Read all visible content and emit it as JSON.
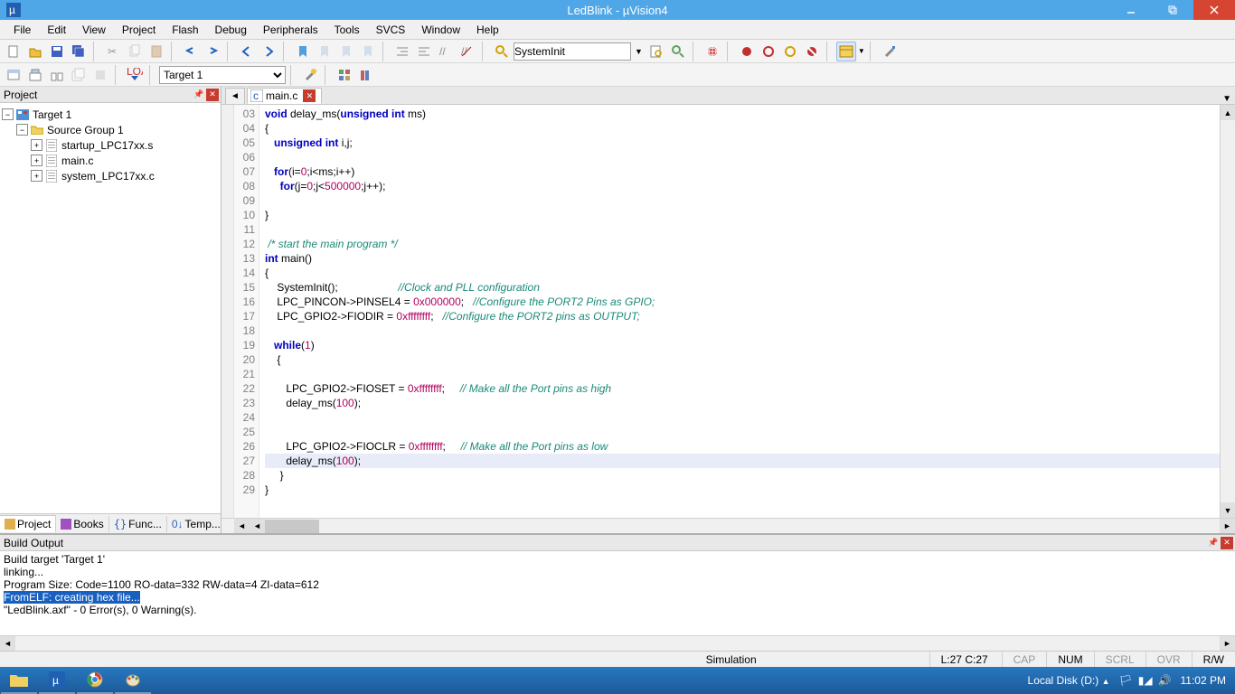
{
  "window": {
    "title": "LedBlink  - µVision4"
  },
  "menu": [
    "File",
    "Edit",
    "View",
    "Project",
    "Flash",
    "Debug",
    "Peripherals",
    "Tools",
    "SVCS",
    "Window",
    "Help"
  ],
  "toolbar": {
    "combo": "SystemInit",
    "target": "Target 1"
  },
  "project": {
    "title": "Project",
    "root": "Target 1",
    "group": "Source Group 1",
    "files": [
      "startup_LPC17xx.s",
      "main.c",
      "system_LPC17xx.c"
    ],
    "tabs": [
      "Project",
      "Books",
      "Func...",
      "Temp..."
    ]
  },
  "editor": {
    "filename": "main.c",
    "startline": 3,
    "highlight": 27,
    "lines": [
      [
        [
          "kw",
          "void"
        ],
        [
          "",
          " delay_ms("
        ],
        [
          "kw",
          "unsigned"
        ],
        [
          "",
          " "
        ],
        [
          "kw",
          "int"
        ],
        [
          "",
          " ms)"
        ]
      ],
      [
        [
          "",
          "{"
        ]
      ],
      [
        [
          "",
          "   "
        ],
        [
          "kw",
          "unsigned"
        ],
        [
          "",
          " "
        ],
        [
          "kw",
          "int"
        ],
        [
          "",
          " i,j;"
        ]
      ],
      [
        [
          "",
          ""
        ]
      ],
      [
        [
          "",
          "   "
        ],
        [
          "kw",
          "for"
        ],
        [
          "",
          "(i="
        ],
        [
          "num",
          "0"
        ],
        [
          "",
          ";i<ms;i++)"
        ]
      ],
      [
        [
          "",
          "     "
        ],
        [
          "kw",
          "for"
        ],
        [
          "",
          "(j="
        ],
        [
          "num",
          "0"
        ],
        [
          "",
          ";j<"
        ],
        [
          "num",
          "500000"
        ],
        [
          "",
          ";j++);"
        ]
      ],
      [
        [
          "",
          ""
        ]
      ],
      [
        [
          "",
          "}"
        ]
      ],
      [
        [
          "",
          ""
        ]
      ],
      [
        [
          "cmt",
          " /* start the main program */"
        ]
      ],
      [
        [
          "kw",
          "int"
        ],
        [
          "",
          " main()"
        ]
      ],
      [
        [
          "",
          "{"
        ]
      ],
      [
        [
          "",
          "    SystemInit();                    "
        ],
        [
          "cmt",
          "//Clock and PLL configuration"
        ]
      ],
      [
        [
          "",
          "    LPC_PINCON->PINSEL4 = "
        ],
        [
          "hex",
          "0x000000"
        ],
        [
          "",
          ";   "
        ],
        [
          "cmt",
          "//Configure the PORT2 Pins as GPIO;"
        ]
      ],
      [
        [
          "",
          "    LPC_GPIO2->FIODIR = "
        ],
        [
          "hex",
          "0xffffffff"
        ],
        [
          "",
          ";   "
        ],
        [
          "cmt",
          "//Configure the PORT2 pins as OUTPUT;"
        ]
      ],
      [
        [
          "",
          ""
        ]
      ],
      [
        [
          "",
          "   "
        ],
        [
          "kw",
          "while"
        ],
        [
          "",
          "("
        ],
        [
          "num",
          "1"
        ],
        [
          "",
          ")"
        ]
      ],
      [
        [
          "",
          "    {"
        ]
      ],
      [
        [
          "",
          ""
        ]
      ],
      [
        [
          "",
          "       LPC_GPIO2->FIOSET = "
        ],
        [
          "hex",
          "0xffffffff"
        ],
        [
          "",
          ";     "
        ],
        [
          "cmt",
          "// Make all the Port pins as high"
        ]
      ],
      [
        [
          "",
          "       delay_ms("
        ],
        [
          "num",
          "100"
        ],
        [
          "",
          ");"
        ]
      ],
      [
        [
          "",
          ""
        ]
      ],
      [
        [
          "",
          ""
        ]
      ],
      [
        [
          "",
          "       LPC_GPIO2->FIOCLR = "
        ],
        [
          "hex",
          "0xffffffff"
        ],
        [
          "",
          ";     "
        ],
        [
          "cmt",
          "// Make all the Port pins as low"
        ]
      ],
      [
        [
          "",
          "       delay_ms("
        ],
        [
          "num",
          "100"
        ],
        [
          "",
          ");"
        ]
      ],
      [
        [
          "",
          "     }"
        ]
      ],
      [
        [
          "",
          "}"
        ]
      ]
    ]
  },
  "build": {
    "title": "Build Output",
    "lines": [
      "Build target 'Target 1'",
      "linking...",
      "Program Size: Code=1100 RO-data=332 RW-data=4 ZI-data=612",
      "FromELF: creating hex file...",
      "\"LedBlink.axf\" - 0 Error(s), 0 Warning(s)."
    ],
    "highlight": 3
  },
  "status": {
    "mode": "Simulation",
    "pos": "L:27 C:27",
    "caps": "CAP",
    "num": "NUM",
    "scrl": "SCRL",
    "ovr": "OVR",
    "rw": "R/W"
  },
  "taskbar": {
    "drive": "Local Disk (D:)",
    "time": "11:02 PM"
  }
}
